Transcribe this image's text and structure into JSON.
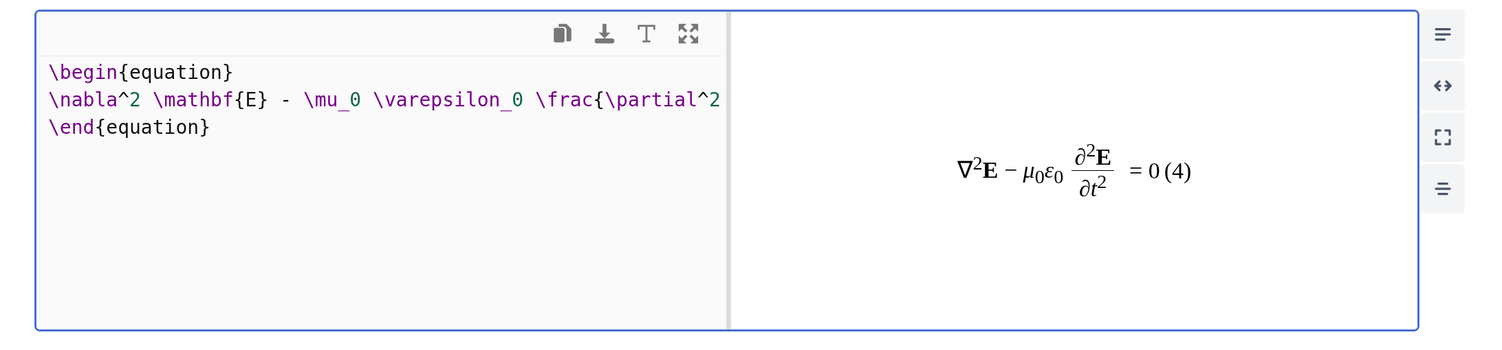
{
  "editor": {
    "code_lines": [
      [
        {
          "kind": "command",
          "text": "\\begin"
        },
        {
          "kind": "text",
          "text": "{equation}"
        }
      ],
      [
        {
          "kind": "command",
          "text": "\\nabla"
        },
        {
          "kind": "text",
          "text": "^"
        },
        {
          "kind": "number",
          "text": "2"
        },
        {
          "kind": "command",
          "text": " \\mathbf"
        },
        {
          "kind": "text",
          "text": "{E} - "
        },
        {
          "kind": "command",
          "text": "\\mu_"
        },
        {
          "kind": "number",
          "text": "0"
        },
        {
          "kind": "command",
          "text": " \\varepsilon_"
        },
        {
          "kind": "number",
          "text": "0"
        },
        {
          "kind": "command",
          "text": " \\frac"
        },
        {
          "kind": "text",
          "text": "{"
        },
        {
          "kind": "command",
          "text": "\\partial"
        },
        {
          "kind": "text",
          "text": "^"
        },
        {
          "kind": "number",
          "text": "2"
        }
      ],
      [
        {
          "kind": "command",
          "text": "\\end"
        },
        {
          "kind": "text",
          "text": "{equation}"
        }
      ]
    ]
  },
  "preview": {
    "lhs": "∇$^{2}$**E** − *μ*$_{0}$*ε*$_{0}$",
    "numerator": "∂$^{2}$**E**",
    "denominator": "∂*t*$^{2}$",
    "rhs": "= 0",
    "equation_number": "(4)"
  }
}
